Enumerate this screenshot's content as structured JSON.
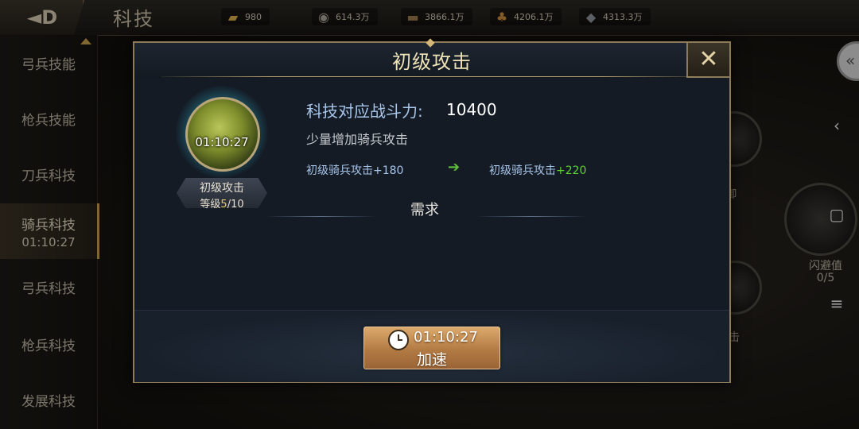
{
  "topbar": {
    "title": "科技",
    "resources": [
      {
        "icon": "gold-ingot-icon",
        "glyph": "▰",
        "value": "980"
      },
      {
        "icon": "coin-icon",
        "glyph": "◉",
        "value": "614.3万"
      },
      {
        "icon": "wood-icon",
        "glyph": "▬",
        "value": "3866.1万"
      },
      {
        "icon": "food-icon",
        "glyph": "♣",
        "value": "4206.1万"
      },
      {
        "icon": "iron-icon",
        "glyph": "◆",
        "value": "4313.3万"
      }
    ]
  },
  "sidebar": {
    "items": [
      {
        "label": "弓兵技能"
      },
      {
        "label": "枪兵技能"
      },
      {
        "label": "刀兵科技"
      },
      {
        "label": "骑兵科技",
        "timer": "01:10:27"
      },
      {
        "label": "弓兵科技"
      },
      {
        "label": "枪兵科技"
      },
      {
        "label": "发展科技"
      }
    ]
  },
  "tree": {
    "labels": [
      "御",
      "闪避值",
      "0/5",
      "击"
    ]
  },
  "modal": {
    "title": "初级攻击",
    "close_glyph": "✕",
    "skill": {
      "timer": "01:10:27",
      "name": "初级攻击",
      "level_prefix": "等级",
      "level_current": "5",
      "level_max": "/10"
    },
    "power_label": "科技对应战斗力:",
    "power_value": "10400",
    "description": "少量增加骑兵攻击",
    "effect_current": "初级骑兵攻击+180",
    "arrow_glyph": "➔",
    "effect_next_text": "初级骑兵攻击",
    "effect_next_value": "+220",
    "requirements_title": "需求",
    "speedup": {
      "time": "01:10:27",
      "label": "加速"
    }
  },
  "sysnav": {
    "back": "‹",
    "home": "▢",
    "menu": "≡"
  },
  "colors": {
    "accent_gold": "#c6a04d",
    "info_blue": "#a8c6ea",
    "bonus_green": "#5fd038",
    "button_bronze": "#b27a43"
  }
}
